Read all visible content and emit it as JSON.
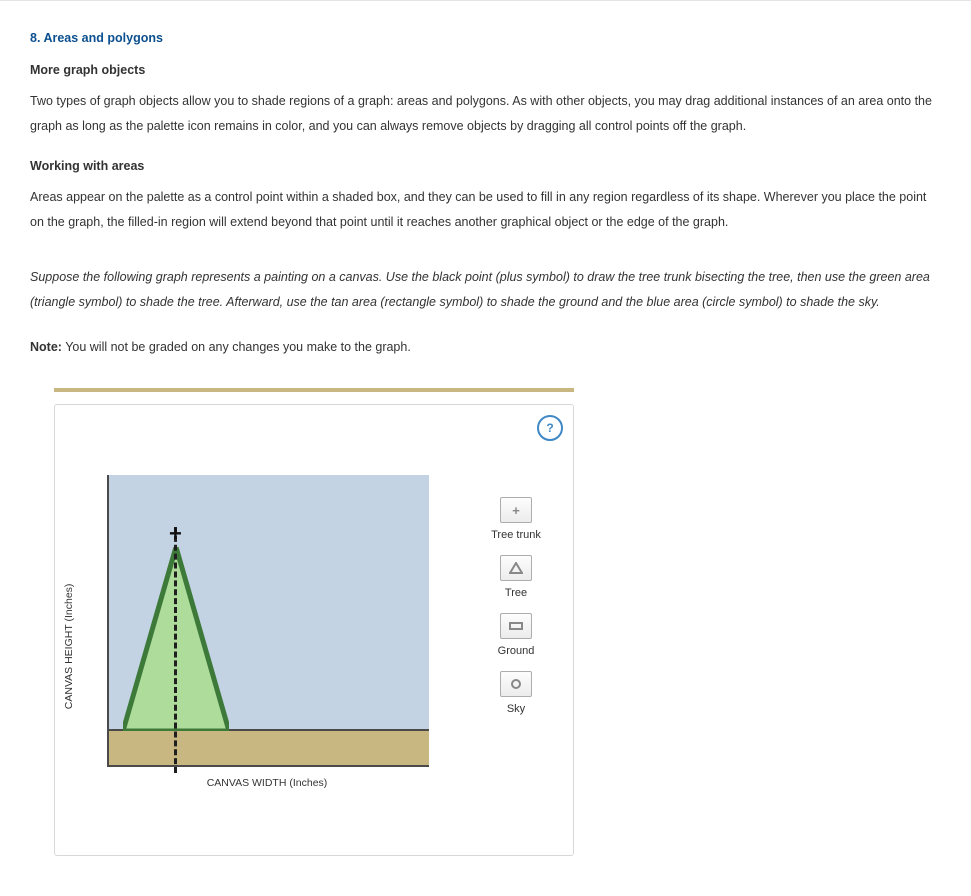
{
  "section": {
    "number": "8.",
    "title": "Areas and polygons"
  },
  "content": {
    "sub1_title": "More graph objects",
    "sub1_body": "Two types of graph objects allow you to shade regions of a graph: areas and polygons. As with other objects, you may drag additional instances of an area onto the graph as long as the palette icon remains in color, and you can always remove objects by dragging all control points off the graph.",
    "sub2_title": "Working with areas",
    "sub2_body": "Areas appear on the palette as a control point within a shaded box, and they can be used to fill in any region regardless of its shape. Wherever you place the point on the graph, the filled-in region will extend beyond that point until it reaches another graphical object or the edge of the graph.",
    "instructions": "Suppose the following graph represents a painting on a canvas. Use the black point (plus symbol) to draw the tree trunk bisecting the tree, then use the green area (triangle symbol) to shade the tree. Afterward, use the tan area (rectangle symbol) to shade the ground and the blue area (circle symbol) to shade the sky.",
    "note_label": "Note:",
    "note_body": " You will not be graded on any changes you make to the graph."
  },
  "widget": {
    "help": "?",
    "x_axis_label": "CANVAS WIDTH (Inches)",
    "y_axis_label": "CANVAS HEIGHT (Inches)",
    "palette": {
      "trunk_label": "Tree trunk",
      "tree_label": "Tree",
      "ground_label": "Ground",
      "sky_label": "Sky"
    },
    "colors": {
      "sky": "#c3d3e3",
      "ground": "#c9b781",
      "tree_fill": "#aedc9a",
      "tree_stroke": "#3d7a3a",
      "accent": "#0b4f8e"
    }
  }
}
